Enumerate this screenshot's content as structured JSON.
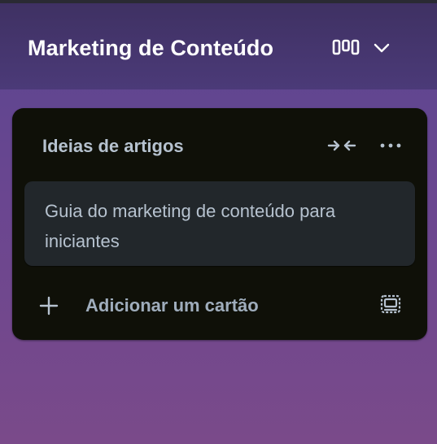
{
  "board": {
    "title": "Marketing de Conteúdo",
    "view_icon": "board-view-icon",
    "dropdown_icon": "chevron-down-icon"
  },
  "list": {
    "title": "Ideias de artigos",
    "collapse_icon": "collapse-icon",
    "more_icon": "more-options-icon",
    "cards": [
      {
        "title": "Guia do marketing de conteúdo para iniciantes"
      }
    ],
    "add_card_label": "Adicionar um cartão",
    "add_icon": "plus-icon",
    "template_icon": "card-template-icon"
  },
  "colors": {
    "header_bg": "#3f3163",
    "background": "#6a4690",
    "list_bg": "#0f1008",
    "card_bg": "#22272b",
    "text": "#b6c2cf"
  }
}
